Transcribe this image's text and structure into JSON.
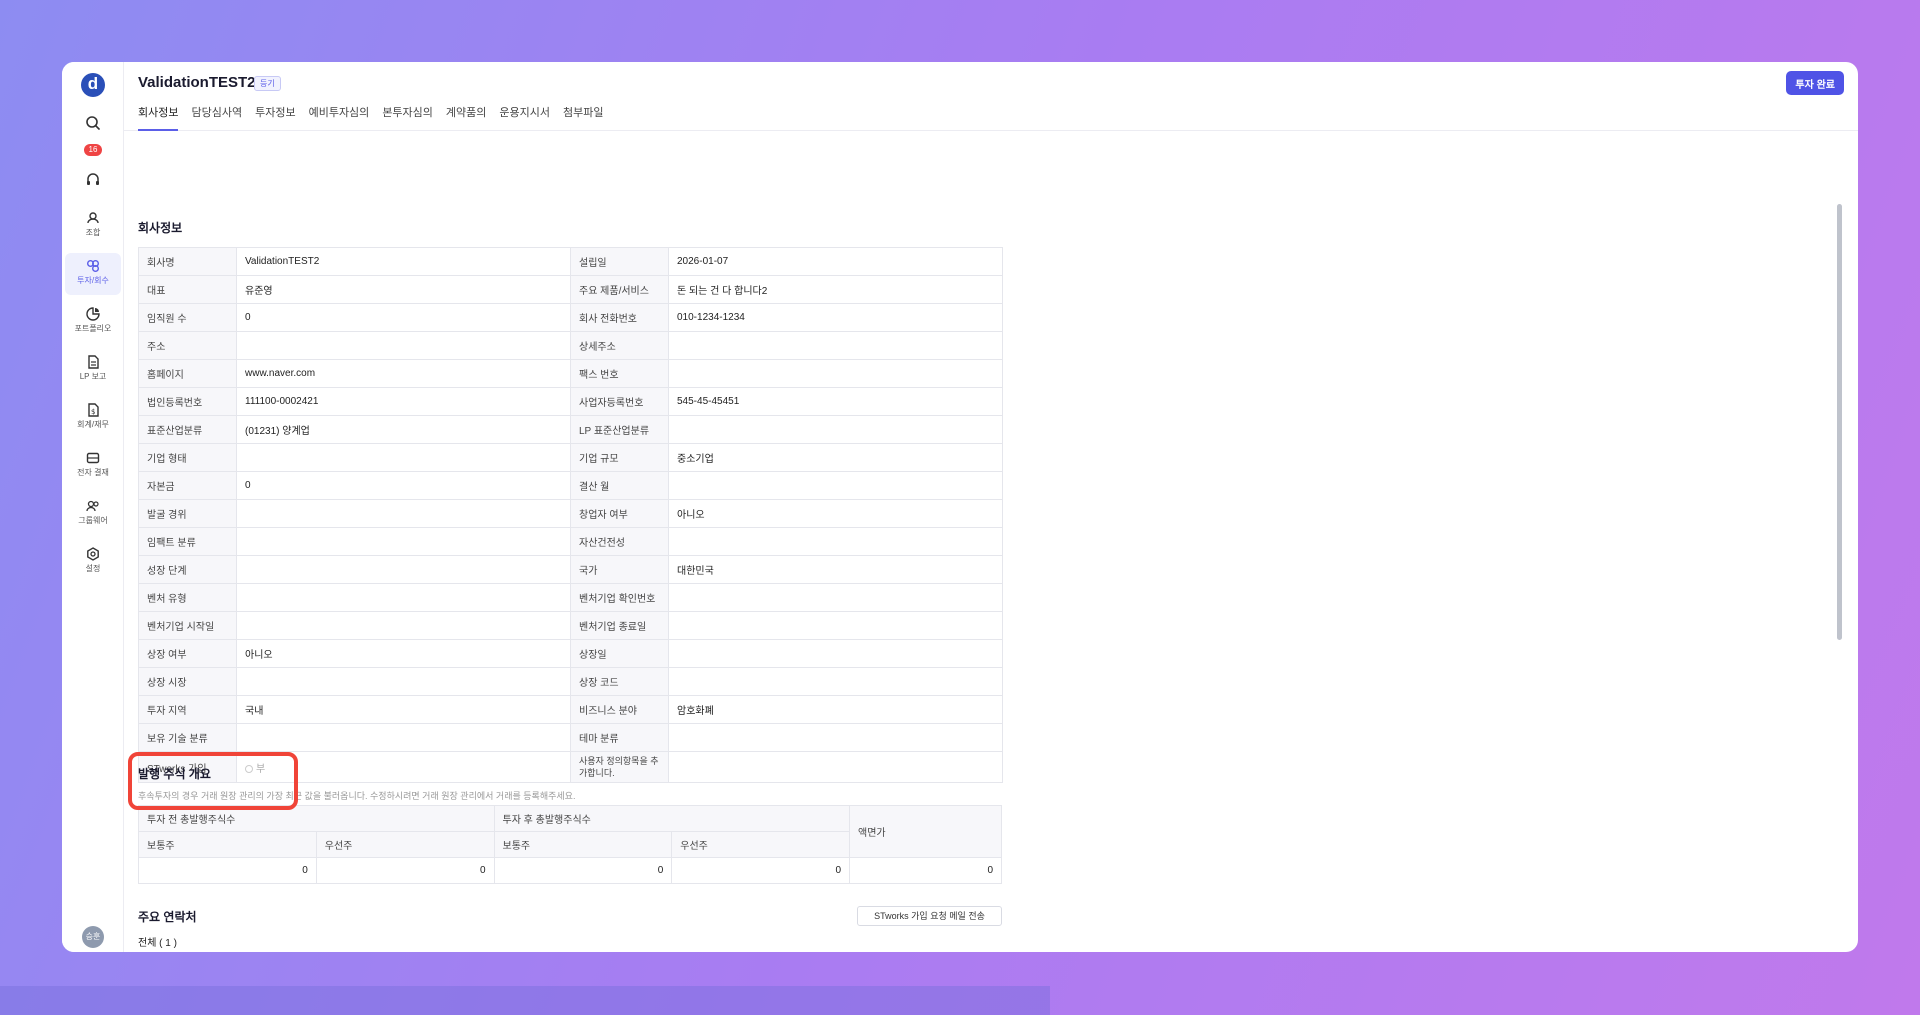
{
  "window": {
    "title": "ValidationTEST2",
    "title_tag": "등기",
    "complete_button": "투자 완료"
  },
  "sidebar": {
    "logo": "d",
    "badge_count": "16",
    "items": [
      {
        "label": "조합",
        "icon": "union-icon"
      },
      {
        "label": "투자/회수",
        "icon": "investment-icon"
      },
      {
        "label": "포트폴리오",
        "icon": "portfolio-icon"
      },
      {
        "label": "LP 보고",
        "icon": "lp-report-icon"
      },
      {
        "label": "회계/재무",
        "icon": "accounting-icon"
      },
      {
        "label": "전자 결재",
        "icon": "approval-icon"
      },
      {
        "label": "그룹웨어",
        "icon": "groupware-icon"
      },
      {
        "label": "설정",
        "icon": "settings-icon"
      }
    ],
    "avatar_initials": "승훈"
  },
  "tabs": [
    "회사정보",
    "담당심사역",
    "투자정보",
    "예비투자심의",
    "본투자심의",
    "계약품의",
    "운용지시서",
    "첨부파일"
  ],
  "company_info": {
    "section_title": "회사정보",
    "rows": [
      [
        "회사명",
        "ValidationTEST2",
        "설립일",
        "2026-01-07"
      ],
      [
        "대표",
        "유준영",
        "주요 제품/서비스",
        "돈 되는 건 다 합니다2"
      ],
      [
        "임직원 수",
        "0",
        "회사 전화번호",
        "010-1234-1234"
      ],
      [
        "주소",
        "",
        "상세주소",
        ""
      ],
      [
        "홈페이지",
        "www.naver.com",
        "팩스 번호",
        ""
      ],
      [
        "법인등록번호",
        "111100-0002421",
        "사업자등록번호",
        "545-45-45451"
      ],
      [
        "표준산업분류",
        "(01231) 양계업",
        "LP 표준산업분류",
        ""
      ],
      [
        "기업 형태",
        "",
        "기업 규모",
        "중소기업"
      ],
      [
        "자본금",
        "0",
        "결산 월",
        ""
      ],
      [
        "발굴 경위",
        "",
        "창업자 여부",
        "아니오"
      ],
      [
        "임팩트 분류",
        "",
        "자산건전성",
        ""
      ],
      [
        "성장 단계",
        "",
        "국가",
        "대한민국"
      ],
      [
        "벤처 유형",
        "",
        "벤처기업 확인번호",
        ""
      ],
      [
        "벤처기업 시작일",
        "",
        "벤처기업 종료일",
        ""
      ],
      [
        "상장 여부",
        "아니오",
        "상장일",
        ""
      ],
      [
        "상장 시장",
        "",
        "상장 코드",
        ""
      ],
      [
        "투자 지역",
        "국내",
        "비즈니스 분야",
        "암호화폐"
      ],
      [
        "보유 기술 분류",
        "",
        "테마 분류",
        ""
      ]
    ],
    "stworks_label": "STworks 가입",
    "stworks_value": "부",
    "custom_field_label": "사용자 정의항목을 추가합니다."
  },
  "shares": {
    "section_title": "발행 주식 개요",
    "note": "후속투자의 경우 거래 원장 관리의 가장 최근 값을 불러옵니다. 수정하시려면 거래 원장 관리에서 거래를 등록해주세요.",
    "before_header": "투자 전 총발행주식수",
    "after_header": "투자 후 총발행주식수",
    "par_value_header": "액면가",
    "common_label": "보통주",
    "preferred_label": "우선주",
    "values": [
      "0",
      "0",
      "0",
      "0",
      "0"
    ]
  },
  "contacts": {
    "section_title": "주요 연락처",
    "mail_button": "STworks 가입 요청 메일 전송",
    "count_label": "전체 ( 1 )"
  }
}
